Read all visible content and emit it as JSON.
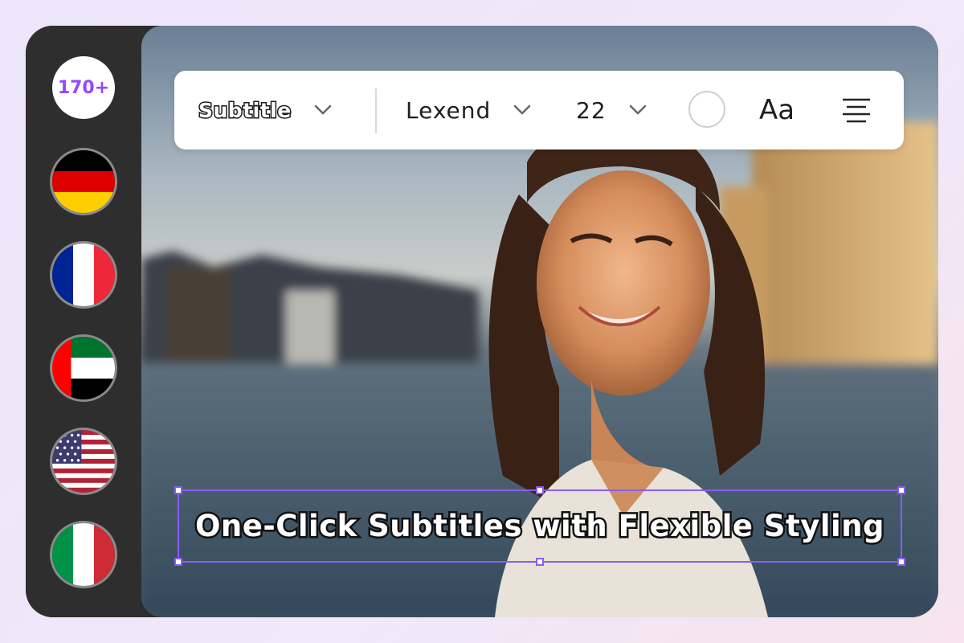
{
  "sidebar": {
    "language_count_badge": "170+",
    "flags": [
      {
        "name": "germany"
      },
      {
        "name": "france"
      },
      {
        "name": "uae"
      },
      {
        "name": "usa"
      },
      {
        "name": "italy"
      }
    ]
  },
  "toolbar": {
    "style_label": "Subtitle",
    "font_label": "Lexend",
    "font_size": "22",
    "case_label": "Aa",
    "icons": [
      "chevron-down-icon",
      "color-swatch-icon",
      "text-case-icon",
      "align-center-icon"
    ]
  },
  "caption": {
    "text": "One-Click Subtitles with Flexible Styling"
  },
  "colors": {
    "accent": "#8b5cf6",
    "badge_text": "#9747ff",
    "sidebar_bg": "#2f2e2f"
  }
}
